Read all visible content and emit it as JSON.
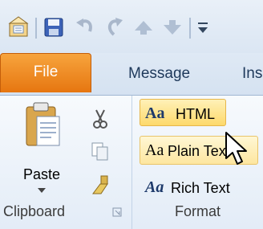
{
  "tabs": {
    "file": "File",
    "message": "Message",
    "insert_partial": "Ins"
  },
  "clipboard": {
    "paste_label": "Paste",
    "group_label": "Clipboard"
  },
  "format": {
    "html_label": "HTML",
    "plain_text_label": "Plain Text",
    "rich_text_label": "Rich Text",
    "group_label": "Format",
    "aa_glyph": "Aa"
  },
  "colors": {
    "file_tab": "#e67610",
    "selected_highlight": "#fde48a",
    "ribbon_text": "#1e395b"
  },
  "icons": [
    "mail-app-icon",
    "save-icon",
    "undo-icon",
    "redo-icon",
    "up-arrow-icon",
    "down-arrow-icon",
    "customize-qat-icon",
    "paste-icon",
    "cut-icon",
    "copy-icon",
    "format-painter-icon",
    "dialog-launcher-icon",
    "cursor-icon"
  ]
}
